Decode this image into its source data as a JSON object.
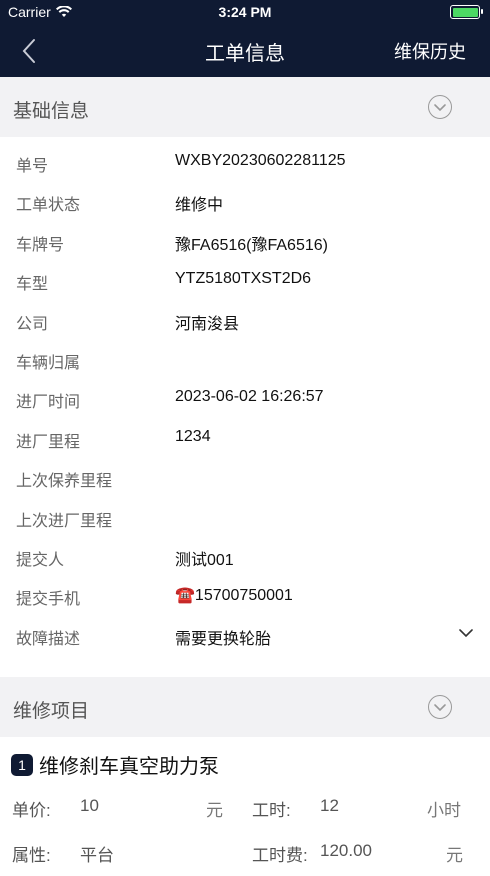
{
  "status_bar": {
    "carrier": "Carrier",
    "time": "3:24 PM"
  },
  "nav": {
    "title": "工单信息",
    "right_label": "维保历史"
  },
  "basic_section": {
    "title": "基础信息",
    "rows": [
      {
        "label": "单号",
        "value": "WXBY20230602281125"
      },
      {
        "label": "工单状态",
        "value": "维修中"
      },
      {
        "label": "车牌号",
        "value": "豫FA6516(豫FA6516)"
      },
      {
        "label": "车型",
        "value": "YTZ5180TXST2D6"
      },
      {
        "label": "公司",
        "value": "河南浚县"
      },
      {
        "label": "车辆归属",
        "value": ""
      },
      {
        "label": "进厂时间",
        "value": "2023-06-02 16:26:57"
      },
      {
        "label": "进厂里程",
        "value": "1234"
      },
      {
        "label": "上次保养里程",
        "value": ""
      },
      {
        "label": "上次进厂里程",
        "value": ""
      },
      {
        "label": "提交人",
        "value": "测试001"
      },
      {
        "label": "提交手机",
        "value": "☎️15700750001"
      },
      {
        "label": "故障描述",
        "value": "需要更换轮胎"
      }
    ]
  },
  "repair_section": {
    "title": "维修项目",
    "items": [
      {
        "index": "1",
        "name": "维修刹车真空助力泵",
        "unit_price_label": "单价:",
        "unit_price": "10",
        "unit_price_unit": "元",
        "hours_label": "工时:",
        "hours": "12",
        "hours_unit": "小时",
        "attr_label": "属性:",
        "attr": "平台",
        "fee_label": "工时费:",
        "fee": "120.00",
        "fee_unit": "元"
      }
    ]
  },
  "colors": {
    "header_bg": "#0f1a33",
    "section_bg": "#f2f2f4",
    "battery": "#4cd964"
  },
  "battery_level": 1.0
}
